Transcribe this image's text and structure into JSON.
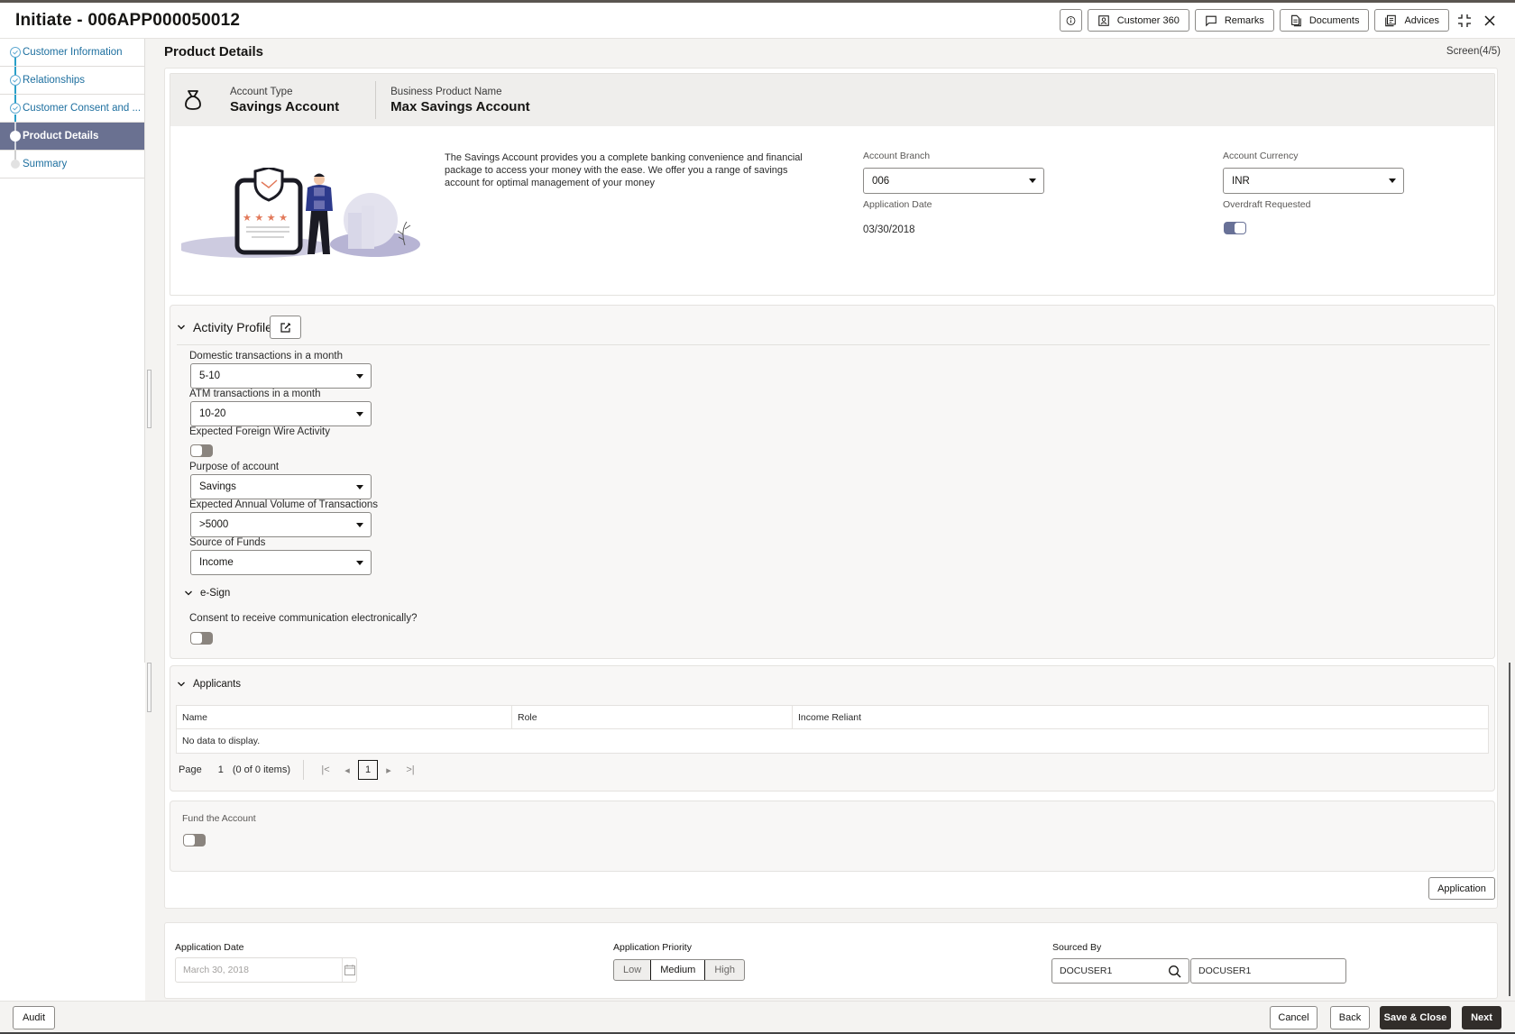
{
  "header": {
    "title": "Initiate - 006APP000050012",
    "buttons": [
      {
        "label": "",
        "icon": "info-icon"
      },
      {
        "label": "Customer 360",
        "icon": "user-card-icon"
      },
      {
        "label": "Remarks",
        "icon": "chat-icon"
      },
      {
        "label": "Documents",
        "icon": "documents-icon"
      },
      {
        "label": "Advices",
        "icon": "advices-icon"
      }
    ],
    "minimize_icon": "collapse-icon",
    "close_icon": "close-icon"
  },
  "sidebar": {
    "items": [
      {
        "label": "Customer Information",
        "state": "done"
      },
      {
        "label": "Relationships",
        "state": "done"
      },
      {
        "label": "Customer Consent and ...",
        "state": "done"
      },
      {
        "label": "Product Details",
        "state": "active"
      },
      {
        "label": "Summary",
        "state": "pending"
      }
    ]
  },
  "page": {
    "title": "Product Details",
    "screen_indicator": "Screen(4/5)"
  },
  "product": {
    "account_type_label": "Account Type",
    "account_type": "Savings Account",
    "business_product_label": "Business Product Name",
    "business_product": "Max Savings Account",
    "description": "The Savings Account provides you a complete banking convenience and financial package to access your money with the ease. We offer you a range of savings account for optimal management of your money",
    "account_branch_label": "Account Branch",
    "account_branch": "006",
    "account_currency_label": "Account Currency",
    "account_currency": "INR",
    "application_date_label": "Application Date",
    "application_date": "03/30/2018",
    "overdraft_label": "Overdraft Requested",
    "overdraft_requested": true
  },
  "activity_profile": {
    "title": "Activity Profile",
    "fields": {
      "domestic_label": "Domestic transactions in a month",
      "domestic_value": "5-10",
      "atm_label": "ATM transactions in a month",
      "atm_value": "10-20",
      "foreign_wire_label": "Expected Foreign Wire Activity",
      "foreign_wire": false,
      "purpose_label": "Purpose of account",
      "purpose_value": "Savings",
      "annual_volume_label": "Expected Annual Volume of Transactions",
      "annual_volume_value": ">5000",
      "source_funds_label": "Source of Funds",
      "source_funds_value": "Income"
    },
    "esign": {
      "title": "e-Sign",
      "consent_label": "Consent to receive communication electronically?",
      "consent": false
    }
  },
  "applicants": {
    "title": "Applicants",
    "columns": [
      "Name",
      "Role",
      "Income Reliant"
    ],
    "empty_text": "No data to display.",
    "pager": {
      "page_label": "Page",
      "page": "1",
      "items_text": "(0 of 0 items)",
      "current": "1"
    }
  },
  "fund_account": {
    "label": "Fund the Account",
    "enabled": false
  },
  "application_button": "Application",
  "bottom": {
    "app_date_label": "Application Date",
    "app_date_value": "March 30, 2018",
    "priority_label": "Application Priority",
    "priority_options": [
      "Low",
      "Medium",
      "High"
    ],
    "priority_selected": "Medium",
    "sourced_by_label": "Sourced By",
    "sourced_by_id": "DOCUSER1",
    "sourced_by_name": "DOCUSER1"
  },
  "footer": {
    "audit": "Audit",
    "cancel": "Cancel",
    "back": "Back",
    "save_close": "Save & Close",
    "next": "Next"
  },
  "colors": {
    "active_step": "#6a7191",
    "primary_dark": "#312d2a",
    "link": "#1d6f9f",
    "toggle_on": "#687197"
  }
}
